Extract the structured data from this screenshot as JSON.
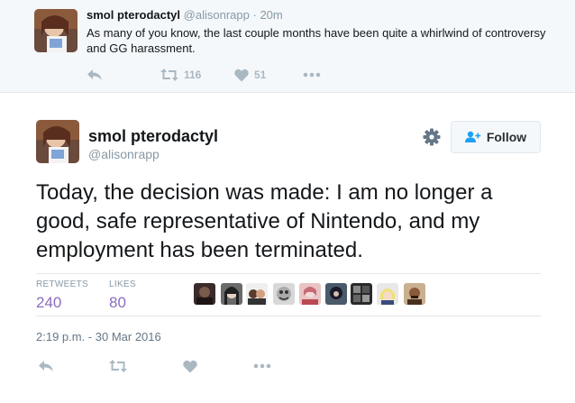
{
  "parent_tweet": {
    "name": "smol pterodactyl",
    "handle": "@alisonrapp",
    "separator": "·",
    "time": "20m",
    "text": "As many of you know, the last couple months have been quite a whirlwind of controversy and GG harassment.",
    "retweet_count": "116",
    "like_count": "51"
  },
  "main_tweet": {
    "name": "smol pterodactyl",
    "handle": "@alisonrapp",
    "follow_label": "Follow",
    "text": "Today, the decision was made: I am no longer a good, safe representative of Nintendo, and my employment has been terminated.",
    "stats": {
      "retweets_label": "RETWEETS",
      "retweets_value": "240",
      "likes_label": "LIKES",
      "likes_value": "80"
    },
    "timestamp": "2:19 p.m. - 30 Mar 2016"
  },
  "colors": {
    "stat_value": "#8c6bc0",
    "follow_icon": "#1da1f2",
    "icon_gray": "#aab8c2"
  },
  "icons": {
    "reply": "reply-icon",
    "retweet": "retweet-icon",
    "like": "heart-icon",
    "more": "more-icon",
    "settings": "gear-icon",
    "follow": "add-user-icon"
  },
  "liker_count": 9
}
